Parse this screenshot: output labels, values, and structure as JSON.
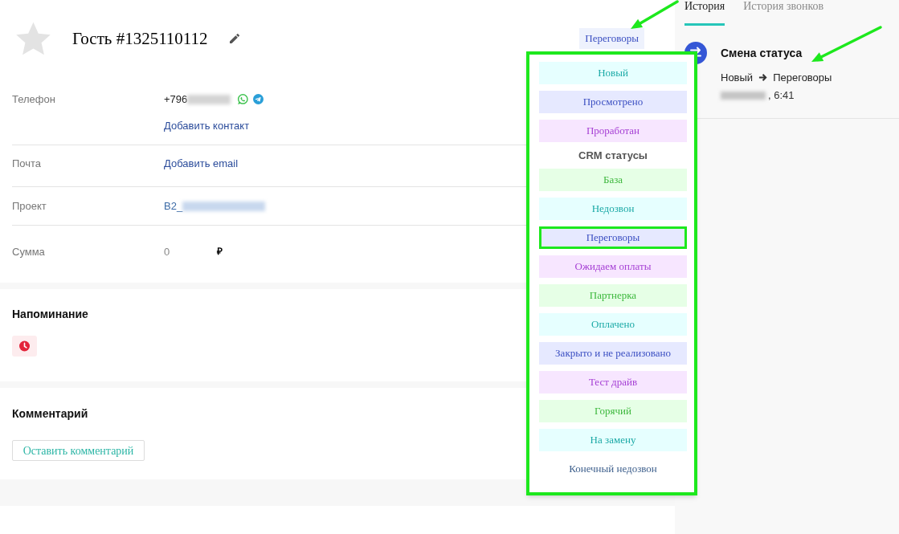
{
  "contact": {
    "favorite": false,
    "name": "Гость #1325110112",
    "status_button": "Переговоры"
  },
  "fields": [
    {
      "kind": "phone",
      "label": "Телефон",
      "value": "+796",
      "redacted": true,
      "link": "Добавить контакт"
    },
    {
      "kind": "email",
      "label": "Почта",
      "link": "Добавить email"
    },
    {
      "kind": "project",
      "label": "Проект",
      "value": "B2_",
      "redacted": true
    },
    {
      "kind": "amount",
      "label": "Сумма",
      "value": "0",
      "currency": "₽"
    }
  ],
  "reminder": {
    "title": "Напоминание"
  },
  "comment": {
    "title": "Комментарий",
    "button": "Оставить комментарий"
  },
  "tabs": [
    {
      "label": "История",
      "selected": true
    },
    {
      "label": "История звонков",
      "selected": false
    }
  ],
  "history": [
    {
      "title": "Смена статуса",
      "from": "Новый",
      "to": "Переговоры",
      "date_redacted": true,
      "time": ", 6:41"
    }
  ],
  "dropdown": {
    "statuses": [
      {
        "label": "Новый",
        "kind": "tinted",
        "color": "#1ba9a6",
        "selected": false
      },
      {
        "label": "Просмотрено",
        "kind": "tinted",
        "color": "#3b4fc2",
        "selected": false
      },
      {
        "label": "Проработан",
        "kind": "tinted",
        "color": "#a53fd4",
        "selected": false
      }
    ],
    "groups": [
      {
        "title": "CRM статусы",
        "statuses": [
          {
            "label": "База",
            "kind": "tinted",
            "color": "#3db83d",
            "selected": false
          },
          {
            "label": "Недозвон",
            "kind": "tinted",
            "color": "#1ba9a6",
            "selected": false
          },
          {
            "label": "Переговоры",
            "kind": "tinted",
            "color": "#3b4fc2",
            "selected": true
          },
          {
            "label": "Ожидаем оплаты",
            "kind": "tinted",
            "color": "#a53fd4",
            "selected": false
          },
          {
            "label": "Партнерка",
            "kind": "tinted",
            "color": "#3db83d",
            "selected": false
          },
          {
            "label": "Оплачено",
            "kind": "tinted",
            "color": "#1ba9a6",
            "selected": false
          },
          {
            "label": "Закрыто и не реализовано",
            "kind": "tinted",
            "color": "#3b4fc2",
            "selected": false
          },
          {
            "label": "Тест драйв",
            "kind": "tinted",
            "color": "#a53fd4",
            "selected": false
          },
          {
            "label": "Горячий",
            "kind": "tinted",
            "color": "#3db83d",
            "selected": false
          },
          {
            "label": "На замену",
            "kind": "tinted",
            "color": "#1ba9a6",
            "selected": false
          },
          {
            "label": "Конечный недозвон",
            "kind": "plain",
            "color": "#3d5f8c",
            "selected": false
          }
        ]
      }
    ]
  }
}
